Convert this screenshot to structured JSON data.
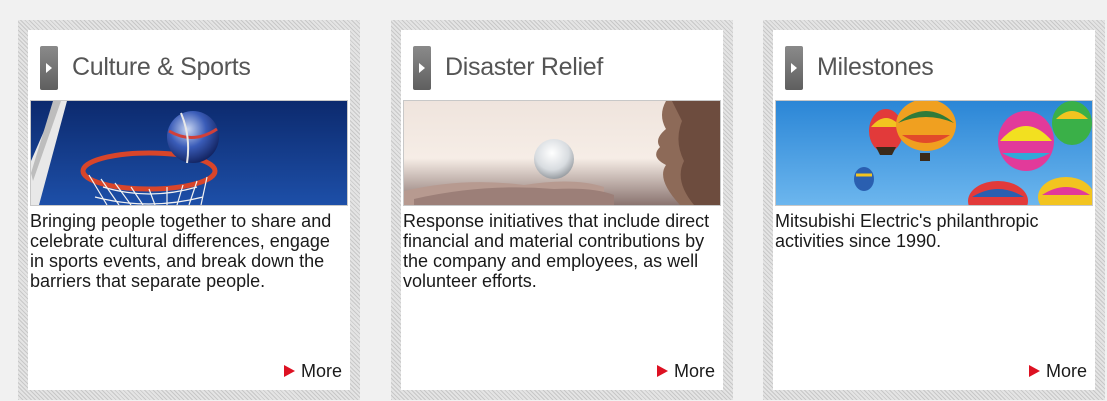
{
  "cards": [
    {
      "title": "Culture & Sports",
      "image": "basketball-hoop-image",
      "description": "Bringing people together to share and celebrate cultural differences, engage in sports events, and break down the barriers that separate people.",
      "more": "More"
    },
    {
      "title": "Disaster Relief",
      "image": "glass-sphere-in-hand-image",
      "description": "Response initiatives that include direct financial and material contributions by the company and employees, as well volunteer efforts.",
      "more": "More"
    },
    {
      "title": "Milestones",
      "image": "hot-air-balloons-image",
      "description": "Mitsubishi Electric's philanthropic activities since 1990.",
      "more": "More"
    }
  ],
  "colors": {
    "background": "#f1f1f1",
    "title_text": "#555555",
    "arrow_red": "#dd1122",
    "tab_gray": "#6e6e6e"
  }
}
